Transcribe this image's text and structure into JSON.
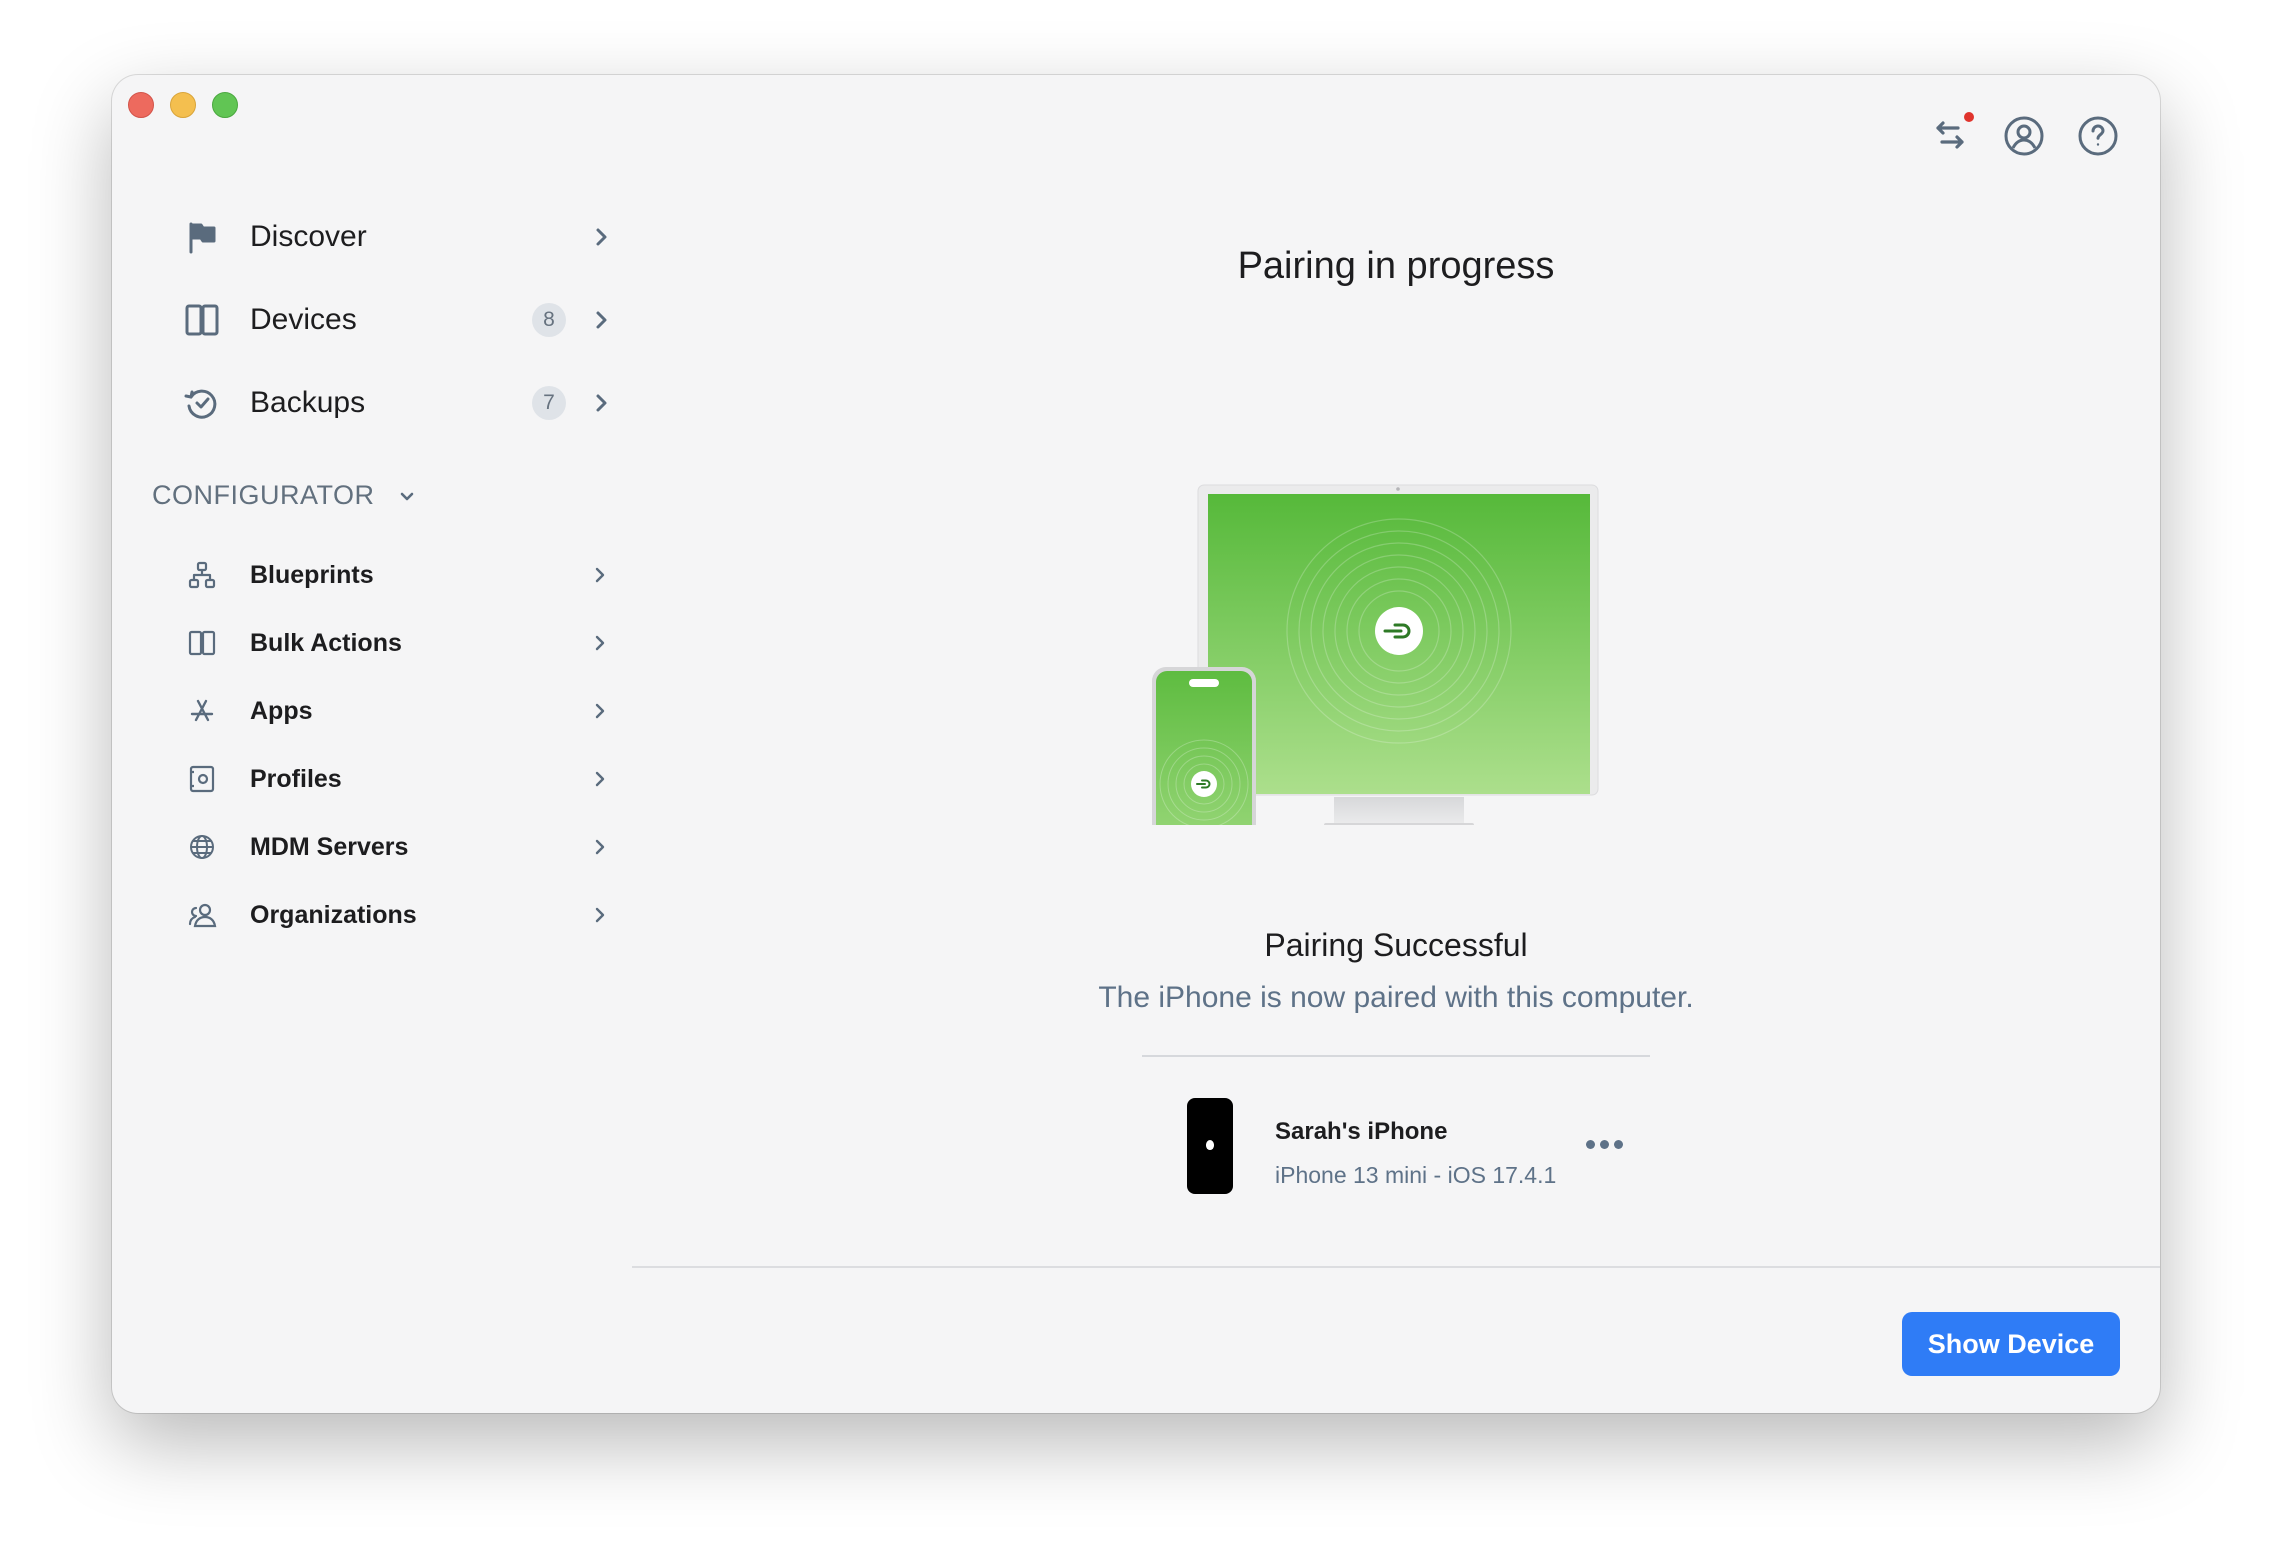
{
  "window": {
    "controls": [
      "close",
      "minimize",
      "zoom"
    ]
  },
  "toolbar": {
    "icons": [
      "transfer-arrows-icon",
      "account-icon",
      "help-icon"
    ]
  },
  "sidebar": {
    "items": [
      {
        "label": "Discover",
        "icon": "flag-icon",
        "badge": null
      },
      {
        "label": "Devices",
        "icon": "devices-icon",
        "badge": "8"
      },
      {
        "label": "Backups",
        "icon": "backup-clock-icon",
        "badge": "7"
      }
    ],
    "section": {
      "title": "CONFIGURATOR",
      "items": [
        {
          "label": "Blueprints",
          "icon": "blueprint-icon"
        },
        {
          "label": "Bulk Actions",
          "icon": "bulk-actions-icon"
        },
        {
          "label": "Apps",
          "icon": "app-store-icon"
        },
        {
          "label": "Profiles",
          "icon": "profile-gear-icon"
        },
        {
          "label": "MDM Servers",
          "icon": "globe-icon"
        },
        {
          "label": "Organizations",
          "icon": "people-icon"
        }
      ]
    }
  },
  "main": {
    "title": "Pairing in progress",
    "status_title": "Pairing Successful",
    "status_subtitle": "The iPhone is now paired with this computer.",
    "device": {
      "name": "Sarah's iPhone",
      "info": "iPhone 13 mini - iOS 17.4.1"
    },
    "primary_button": "Show Device"
  },
  "colors": {
    "accent": "#2f7cf6",
    "pairing_green": "#5cbb3f",
    "notification": "#e0342d"
  }
}
